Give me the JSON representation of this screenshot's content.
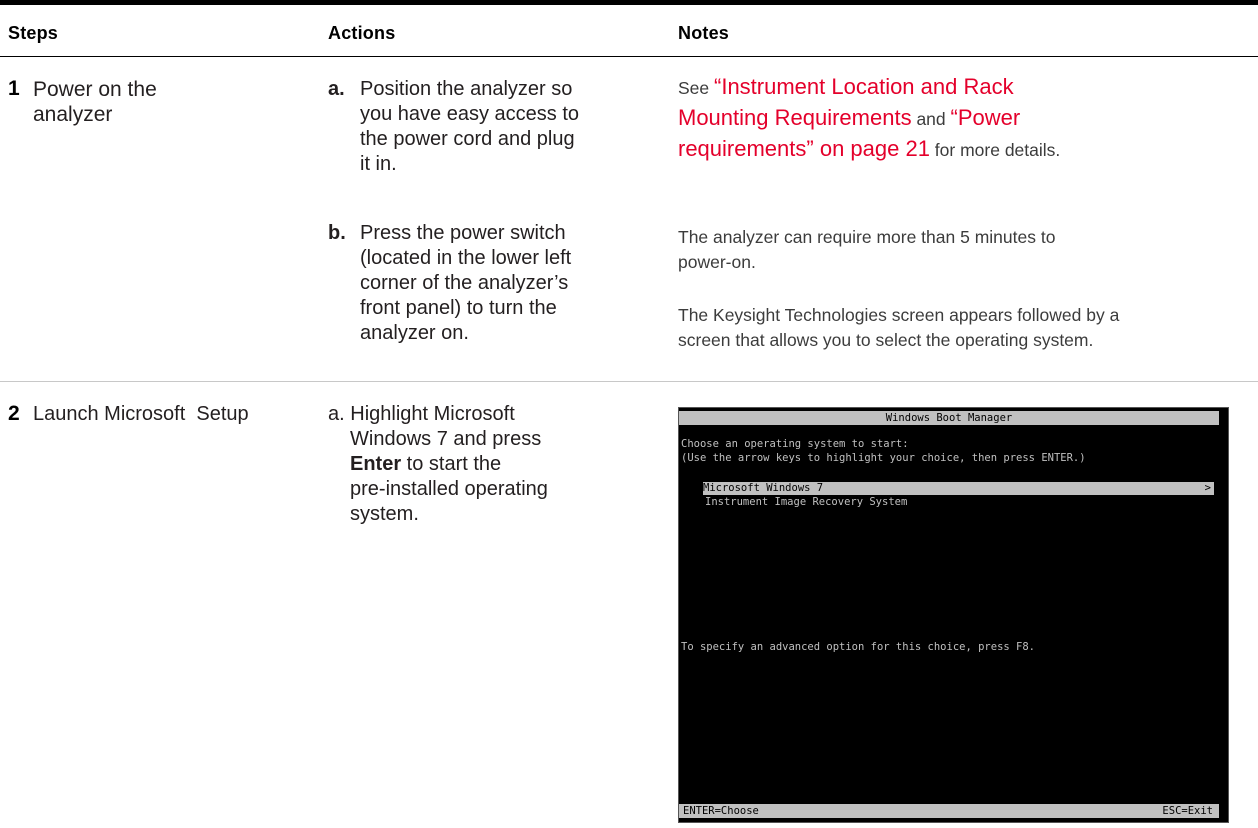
{
  "header": {
    "steps": "Steps",
    "actions": "Actions",
    "notes": "Notes"
  },
  "step1": {
    "number": "1",
    "title_line1": "Power on the",
    "title_line2": "analyzer",
    "action_a": {
      "label": "a.",
      "lines": [
        "Position the analyzer so",
        "you have easy access to",
        "the power cord and plug",
        "it in."
      ]
    },
    "action_b": {
      "label": "b.",
      "lines": [
        "Press the power switch",
        "(located in the lower left",
        "corner of the analyzer’s",
        "front panel) to turn the",
        "analyzer on."
      ]
    },
    "note_a": {
      "prefix": "See ",
      "link1_line1": "“Instrument Location and Rack",
      "link1_line2": "Mounting Requirements",
      "middle": " and ",
      "link2_part1": "“Power",
      "link2_line2": "requirements” on page 21",
      "suffix": " for more details."
    },
    "note_b1_line1": "The analyzer can require more than 5 minutes to",
    "note_b1_line2": "power-on.",
    "note_b2_line1": "The Keysight Technologies screen appears followed by a",
    "note_b2_line2": "screen that allows you to select the operating system."
  },
  "step2": {
    "number": "2",
    "title": "Launch Microsoft  Setup",
    "action": {
      "label": "a.",
      "line1": "Highlight Microsoft",
      "line2": "Windows 7 and press",
      "enter": "Enter",
      "line3_rest": " to start the",
      "line4": "pre-installed operating",
      "line5": "system."
    }
  },
  "boot_screen": {
    "title": "Windows Boot Manager",
    "prompt": "Choose an operating system to start:",
    "hint": "(Use the arrow keys to highlight your choice, then press ENTER.)",
    "selected": "Microsoft Windows 7",
    "selected_arrow": ">",
    "option2": "Instrument Image Recovery System",
    "advanced": "To specify an advanced option for this choice, press F8.",
    "footer_left": "ENTER=Choose",
    "footer_right": "ESC=Exit"
  }
}
